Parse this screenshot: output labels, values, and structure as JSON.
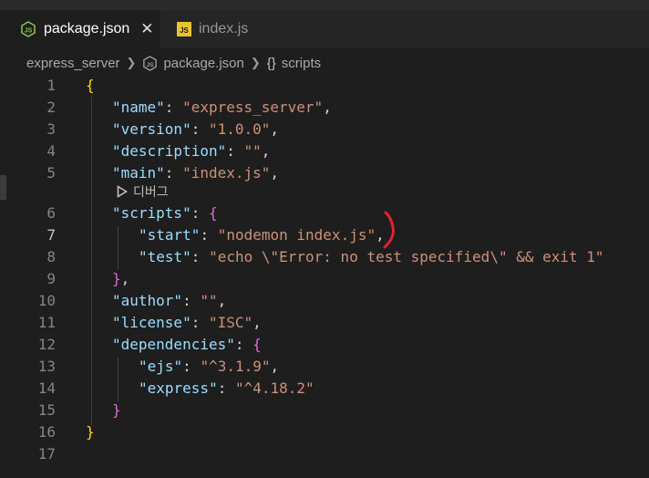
{
  "tabs": [
    {
      "label": "package.json",
      "active": true,
      "icon": "nodejs-json-icon"
    },
    {
      "label": "index.js",
      "active": false,
      "icon": "javascript-icon"
    }
  ],
  "close_glyph": "✕",
  "breadcrumb": {
    "folder": "express_server",
    "file": "package.json",
    "braces": "{}",
    "symbol": "scripts"
  },
  "codelens": {
    "label": "디버그"
  },
  "editor": {
    "current_line": 7,
    "lines": [
      {
        "n": "1"
      },
      {
        "n": "2"
      },
      {
        "n": "3"
      },
      {
        "n": "4"
      },
      {
        "n": "5"
      },
      {
        "n": "6"
      },
      {
        "n": "7"
      },
      {
        "n": "8"
      },
      {
        "n": "9"
      },
      {
        "n": "10"
      },
      {
        "n": "11"
      },
      {
        "n": "12"
      },
      {
        "n": "13"
      },
      {
        "n": "14"
      },
      {
        "n": "15"
      },
      {
        "n": "16"
      },
      {
        "n": "17"
      }
    ],
    "tokens": {
      "l1_open": "{",
      "l2_key": "\"name\"",
      "l2_val": "\"express_server\"",
      "l3_key": "\"version\"",
      "l3_val": "\"1.0.0\"",
      "l4_key": "\"description\"",
      "l4_val": "\"\"",
      "l5_key": "\"main\"",
      "l5_val": "\"index.js\"",
      "l6_key": "\"scripts\"",
      "l6_open": "{",
      "l7_key": "\"start\"",
      "l7_val": "\"nodemon index.js\"",
      "l8_key": "\"test\"",
      "l8_val": "\"echo \\\"Error: no test specified\\\" && exit 1\"",
      "l9_close": "}",
      "l10_key": "\"author\"",
      "l10_val": "\"\"",
      "l11_key": "\"license\"",
      "l11_val": "\"ISC\"",
      "l12_key": "\"dependencies\"",
      "l12_open": "{",
      "l13_key": "\"ejs\"",
      "l13_val": "\"^3.1.9\"",
      "l14_key": "\"express\"",
      "l14_val": "\"^4.18.2\"",
      "l15_close": "}",
      "l16_close": "}",
      "colon": ": ",
      "comma": ","
    }
  },
  "colors": {
    "background": "#1e1e1e",
    "key": "#9cdcfe",
    "string": "#ce9178",
    "bracket_level1": "#ffd700",
    "bracket_level2": "#da70d6",
    "bracket_level3": "#179fff",
    "annotation": "#e0242e"
  }
}
